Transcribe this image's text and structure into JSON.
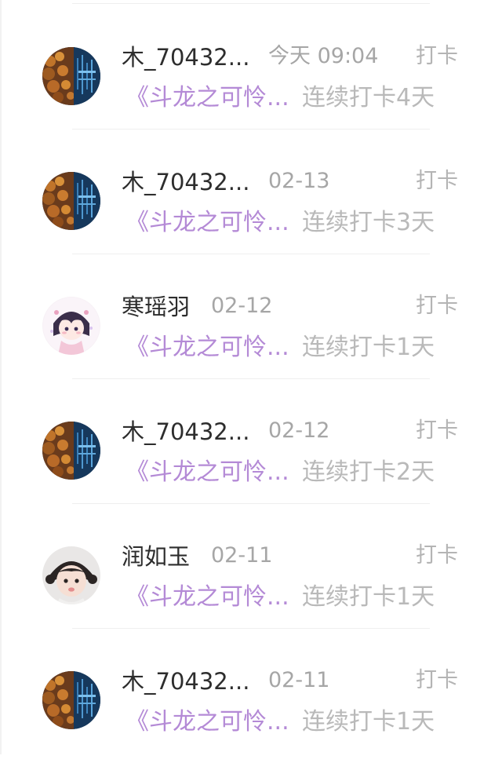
{
  "feed": {
    "items": [
      {
        "name": "木_70432...",
        "time": "今天 09:04",
        "kind": "打卡",
        "book": "《斗龙之可怜...",
        "streak": "连续打卡4天",
        "avatar": "forest-night-avatar"
      },
      {
        "name": "木_70432...",
        "time": "02-13",
        "kind": "打卡",
        "book": "《斗龙之可怜...",
        "streak": "连续打卡3天",
        "avatar": "forest-night-avatar"
      },
      {
        "name": "寒瑶羽",
        "time": "02-12",
        "kind": "打卡",
        "book": "《斗龙之可怜...",
        "streak": "连续打卡1天",
        "avatar": "anime-girl-avatar"
      },
      {
        "name": "木_70432...",
        "time": "02-12",
        "kind": "打卡",
        "book": "《斗龙之可怜...",
        "streak": "连续打卡2天",
        "avatar": "forest-night-avatar"
      },
      {
        "name": "润如玉",
        "time": "02-11",
        "kind": "打卡",
        "book": "《斗龙之可怜...",
        "streak": "连续打卡1天",
        "avatar": "baby-photo-avatar"
      },
      {
        "name": "木_70432...",
        "time": "02-11",
        "kind": "打卡",
        "book": "《斗龙之可怜...",
        "streak": "连续打卡1天",
        "avatar": "forest-night-avatar"
      }
    ]
  },
  "colors": {
    "book_title": "#b48ad6",
    "muted": "#b9b9b9",
    "name": "#2d2d2d"
  }
}
